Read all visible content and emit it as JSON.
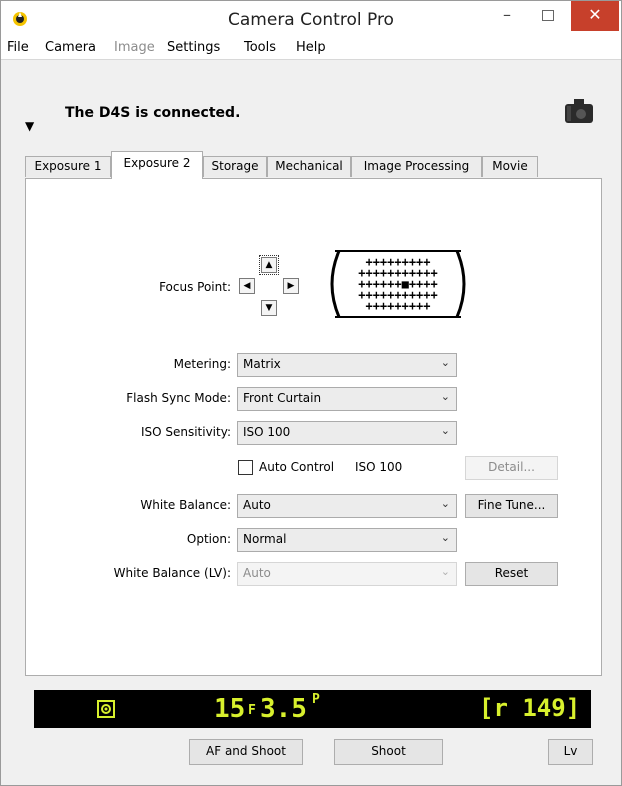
{
  "window": {
    "title": "Camera Control Pro",
    "minimize_glyph": "–",
    "close_glyph": "✕",
    "app_icon": "nikon-camera-control-icon"
  },
  "menu": {
    "items": [
      "File",
      "Camera",
      "Image",
      "Settings",
      "Tools",
      "Help"
    ]
  },
  "status": {
    "text": "The D4S is connected.",
    "expand_glyph": "▼",
    "camera_icon": "camera-icon"
  },
  "tabs": {
    "items": [
      "Exposure 1",
      "Exposure 2",
      "Storage",
      "Mechanical",
      "Image Processing",
      "Movie"
    ],
    "active": "Exposure 2"
  },
  "focus": {
    "label": "Focus Point:",
    "up": "▲",
    "down": "▼",
    "left": "◀",
    "right": "▶",
    "grid_rows": [
      "+++++++++",
      "+++++++++++",
      "++++++■++++",
      "+++++++++++",
      "+++++++++"
    ]
  },
  "fields": {
    "metering": {
      "label": "Metering:",
      "value": "Matrix"
    },
    "flash_sync": {
      "label": "Flash Sync Mode:",
      "value": "Front Curtain"
    },
    "iso": {
      "label": "ISO Sensitivity:",
      "value": "ISO 100"
    },
    "auto_control": {
      "label": "Auto Control",
      "value": "ISO 100",
      "checked": false
    },
    "detail_button": "Detail...",
    "white_balance": {
      "label": "White Balance:",
      "value": "Auto"
    },
    "fine_tune_button": "Fine Tune...",
    "option": {
      "label": "Option:",
      "value": "Normal"
    },
    "white_balance_lv": {
      "label": "White Balance (LV):",
      "value": "Auto"
    },
    "reset_button": "Reset",
    "chevron": "⌄"
  },
  "lcd": {
    "metering_icon": "matrix-metering-icon",
    "shutter": "15",
    "f_prefix": "F",
    "aperture": "3.5",
    "mode": "P",
    "buffer": "[r 149]",
    "color": "#d8f02d"
  },
  "buttons": {
    "af_shoot": "AF and Shoot",
    "shoot": "Shoot",
    "lv": "Lv"
  }
}
